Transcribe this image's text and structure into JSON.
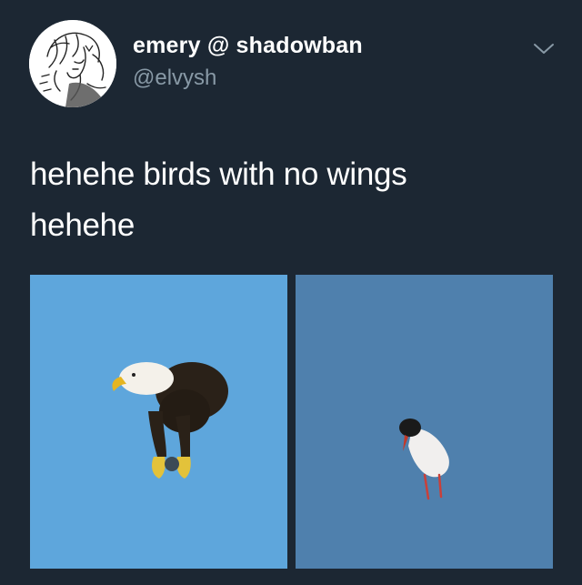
{
  "tweet": {
    "display_name": "emery @ shadowban",
    "handle": "@elvysh",
    "text_line_1": "hehehe birds with no wings",
    "text_line_2": "hehehe",
    "caret_icon": "chevron-down-icon",
    "media": [
      {
        "subject": "bald eagle with no wings",
        "bg_color": "#5ea6dc"
      },
      {
        "subject": "tern with no wings",
        "bg_color": "#4f80ad"
      }
    ]
  },
  "colors": {
    "background": "#1c2733",
    "primary_text": "#ffffff",
    "secondary_text": "#8899a6"
  }
}
